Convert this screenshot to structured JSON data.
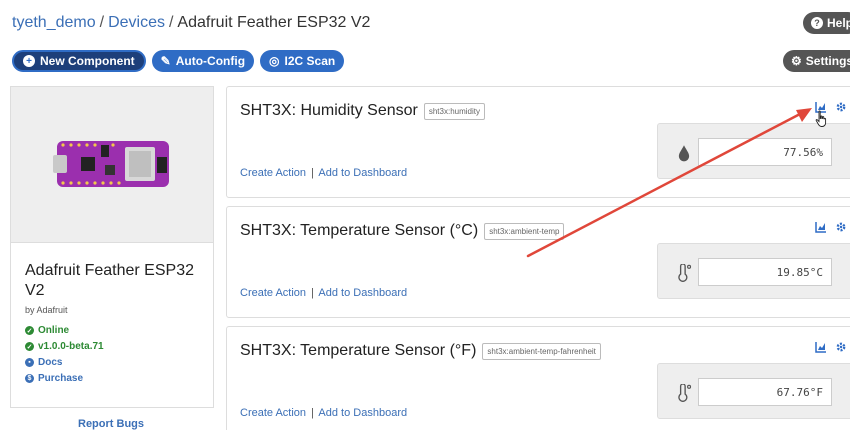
{
  "breadcrumb": {
    "user": "tyeth_demo",
    "section": "Devices",
    "current": "Adafruit Feather ESP32 V2"
  },
  "header": {
    "help_label": "Help",
    "settings_label": "Settings"
  },
  "toolbar": {
    "new_component_label": "New Component",
    "auto_config_label": "Auto-Config",
    "i2c_scan_label": "I2C Scan"
  },
  "device": {
    "name": "Adafruit Feather ESP32 V2",
    "by": "by Adafruit",
    "status": "Online",
    "version": "v1.0.0-beta.71",
    "docs_label": "Docs",
    "purchase_label": "Purchase",
    "report_bugs_label": "Report Bugs"
  },
  "components": [
    {
      "title": "SHT3X: Humidity Sensor",
      "key": "sht3x:humidity",
      "value": "77.56%",
      "icon": "droplet-icon"
    },
    {
      "title": "SHT3X: Temperature Sensor (°C)",
      "key": "sht3x:ambient-temp",
      "value": "19.85°C",
      "icon": "thermometer-icon"
    },
    {
      "title": "SHT3X: Temperature Sensor (°F)",
      "key": "sht3x:ambient-temp-fahrenheit",
      "value": "67.76°F",
      "icon": "thermometer-icon"
    }
  ],
  "component_links": {
    "create_action": "Create Action",
    "separator": "|",
    "add_to_dashboard": "Add to Dashboard"
  },
  "colors": {
    "link": "#3b6fb6",
    "button_blue": "#2f6cc5",
    "button_grey": "#555555",
    "status_green": "#2d8a34",
    "annotation_red": "#e0473a",
    "board_purple": "#9b2fae"
  }
}
